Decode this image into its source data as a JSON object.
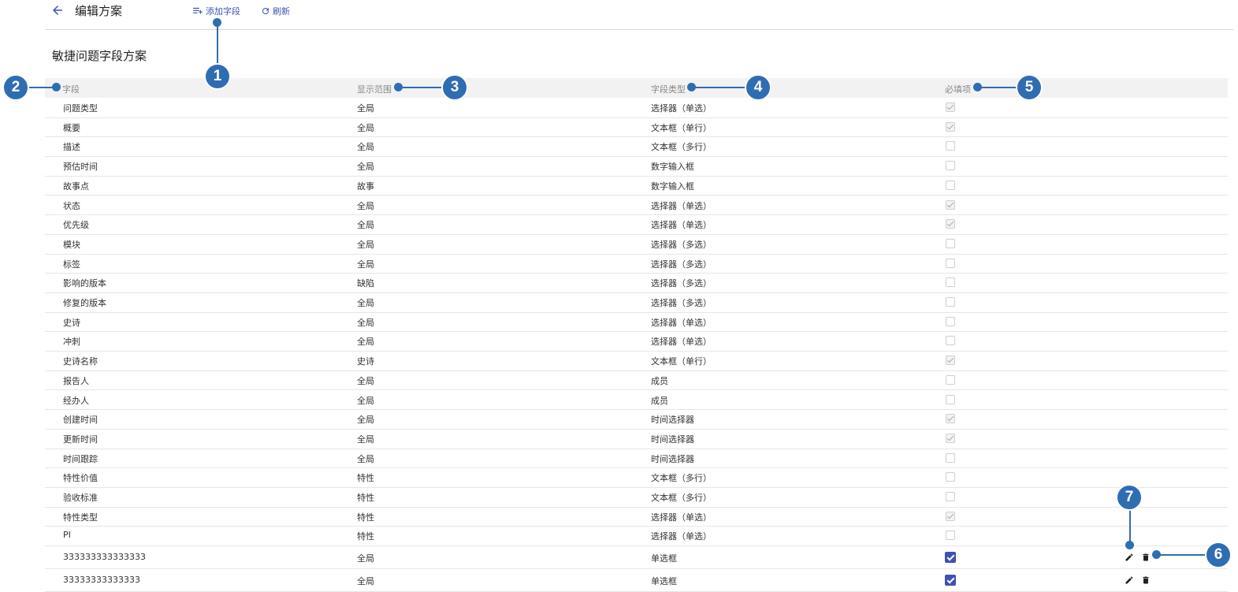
{
  "header": {
    "title": "编辑方案",
    "add_field_label": "添加字段",
    "refresh_label": "刷新"
  },
  "scheme_title": "敏捷问题字段方案",
  "table": {
    "columns": [
      "字段",
      "显示范围",
      "字段类型",
      "必填项"
    ],
    "rows": [
      {
        "field": "问题类型",
        "scope": "全局",
        "type": "选择器（单选）",
        "required": true,
        "editable": false
      },
      {
        "field": "概要",
        "scope": "全局",
        "type": "文本框（单行）",
        "required": true,
        "editable": false
      },
      {
        "field": "描述",
        "scope": "全局",
        "type": "文本框（多行）",
        "required": false,
        "editable": false
      },
      {
        "field": "预估时间",
        "scope": "全局",
        "type": "数字输入框",
        "required": false,
        "editable": false
      },
      {
        "field": "故事点",
        "scope": "故事",
        "type": "数字输入框",
        "required": false,
        "editable": false
      },
      {
        "field": "状态",
        "scope": "全局",
        "type": "选择器（单选）",
        "required": true,
        "editable": false
      },
      {
        "field": "优先级",
        "scope": "全局",
        "type": "选择器（单选）",
        "required": true,
        "editable": false
      },
      {
        "field": "模块",
        "scope": "全局",
        "type": "选择器（多选）",
        "required": false,
        "editable": false
      },
      {
        "field": "标签",
        "scope": "全局",
        "type": "选择器（多选）",
        "required": false,
        "editable": false
      },
      {
        "field": "影响的版本",
        "scope": "缺陷",
        "type": "选择器（多选）",
        "required": false,
        "editable": false
      },
      {
        "field": "修复的版本",
        "scope": "全局",
        "type": "选择器（多选）",
        "required": false,
        "editable": false
      },
      {
        "field": "史诗",
        "scope": "全局",
        "type": "选择器（单选）",
        "required": false,
        "editable": false
      },
      {
        "field": "冲刺",
        "scope": "全局",
        "type": "选择器（单选）",
        "required": false,
        "editable": false
      },
      {
        "field": "史诗名称",
        "scope": "史诗",
        "type": "文本框（单行）",
        "required": true,
        "editable": false
      },
      {
        "field": "报告人",
        "scope": "全局",
        "type": "成员",
        "required": false,
        "editable": false
      },
      {
        "field": "经办人",
        "scope": "全局",
        "type": "成员",
        "required": false,
        "editable": false
      },
      {
        "field": "创建时间",
        "scope": "全局",
        "type": "时间选择器",
        "required": true,
        "editable": false
      },
      {
        "field": "更新时间",
        "scope": "全局",
        "type": "时间选择器",
        "required": true,
        "editable": false
      },
      {
        "field": "时间跟踪",
        "scope": "全局",
        "type": "时间选择器",
        "required": false,
        "editable": false
      },
      {
        "field": "特性价值",
        "scope": "特性",
        "type": "文本框（多行）",
        "required": false,
        "editable": false
      },
      {
        "field": "验收标准",
        "scope": "特性",
        "type": "文本框（多行）",
        "required": false,
        "editable": false
      },
      {
        "field": "特性类型",
        "scope": "特性",
        "type": "选择器（单选）",
        "required": true,
        "editable": false
      },
      {
        "field": "PI",
        "scope": "特性",
        "type": "选择器（单选）",
        "required": false,
        "editable": false
      },
      {
        "field": "333333333333333",
        "scope": "全局",
        "type": "单选框",
        "required": true,
        "editable": true
      },
      {
        "field": "33333333333333",
        "scope": "全局",
        "type": "单选框",
        "required": true,
        "editable": true
      }
    ]
  },
  "icons": {
    "back": "arrow-left-icon",
    "add_field": "playlist-add-icon",
    "refresh": "refresh-icon",
    "edit": "pencil-icon",
    "delete": "trash-icon"
  },
  "callouts": [
    "1",
    "2",
    "3",
    "4",
    "5",
    "6",
    "7"
  ],
  "colors": {
    "accent": "#3f51b5",
    "callout": "#2f6db3"
  }
}
